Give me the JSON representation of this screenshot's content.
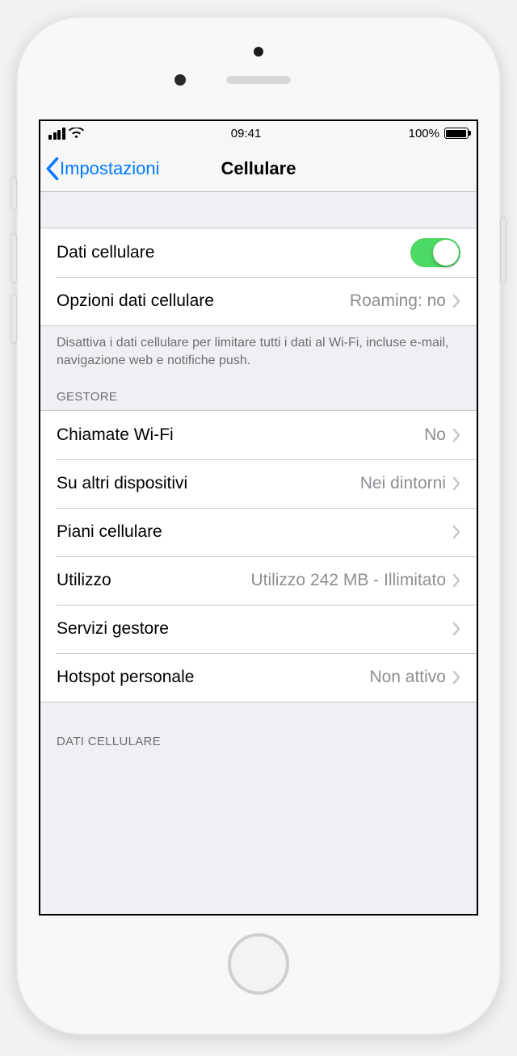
{
  "status": {
    "time": "09:41",
    "battery_pct": "100%"
  },
  "nav": {
    "back_label": "Impostazioni",
    "title": "Cellulare"
  },
  "section1": {
    "cellular_data_label": "Dati cellulare",
    "cellular_data_on": true,
    "options_label": "Opzioni dati cellulare",
    "options_value": "Roaming: no",
    "footer": "Disattiva i dati cellulare per limitare tutti i dati al Wi-Fi, incluse e-mail, navigazione web e notifiche push."
  },
  "carrier": {
    "header": "GESTORE",
    "wifi_calling_label": "Chiamate Wi-Fi",
    "wifi_calling_value": "No",
    "other_devices_label": "Su altri dispositivi",
    "other_devices_value": "Nei dintorni",
    "plans_label": "Piani cellulare",
    "usage_label": "Utilizzo",
    "usage_value": "Utilizzo 242 MB - Illimitato",
    "services_label": "Servizi gestore",
    "hotspot_label": "Hotspot personale",
    "hotspot_value": "Non attivo"
  },
  "data_section": {
    "header": "DATI CELLULARE"
  }
}
